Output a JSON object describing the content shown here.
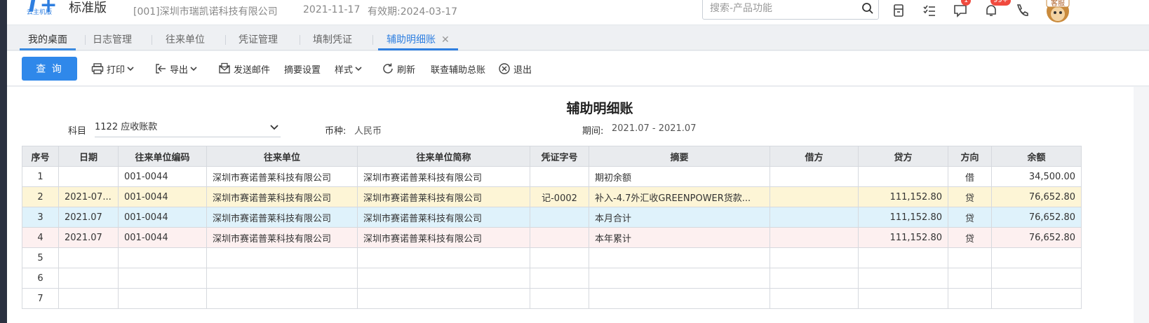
{
  "header": {
    "logo_sub": "云主机版",
    "edition": "标准版",
    "company": "[001]深圳市瑞凯诺科技有限公司",
    "date": "2021-11-17",
    "valid": "有效期:2024-03-17",
    "search_placeholder": "搜索-产品功能",
    "message_badge": "1",
    "notice_badge": "99+",
    "service_label": "客服"
  },
  "tabs": [
    {
      "label": "我的桌面"
    },
    {
      "label": "日志管理"
    },
    {
      "label": "往来单位"
    },
    {
      "label": "凭证管理"
    },
    {
      "label": "填制凭证"
    },
    {
      "label": "辅助明细账"
    }
  ],
  "toolbar": {
    "query": "查 询",
    "print": "打印",
    "export": "导出",
    "send_mail": "发送邮件",
    "summary_settings": "摘要设置",
    "style": "样式",
    "refresh": "刷新",
    "link_total": "联查辅助总账",
    "exit": "退出"
  },
  "report": {
    "title": "辅助明细账",
    "subject_label": "科目",
    "subject_value": "1122 应收账款",
    "currency_label": "币种:",
    "currency_value": "人民币",
    "period_label": "期间:",
    "period_value": "2021.07 - 2021.07"
  },
  "table": {
    "columns": [
      "序号",
      "日期",
      "往来单位编码",
      "往来单位",
      "往来单位简称",
      "凭证字号",
      "摘要",
      "借方",
      "贷方",
      "方向",
      "余额"
    ],
    "rows": [
      [
        "1",
        "",
        "001-0044",
        "深圳市赛诺普莱科技有限公司",
        "深圳市赛诺普莱科技有限公司",
        "",
        "期初余额",
        "",
        "",
        "借",
        "34,500.00"
      ],
      [
        "2",
        "2021-07...",
        "001-0044",
        "深圳市赛诺普莱科技有限公司",
        "深圳市赛诺普莱科技有限公司",
        "记-0002",
        "补入-4.7外汇收GREENPOWER货款...",
        "",
        "111,152.80",
        "贷",
        "76,652.80"
      ],
      [
        "3",
        "2021.07",
        "001-0044",
        "深圳市赛诺普莱科技有限公司",
        "深圳市赛诺普莱科技有限公司",
        "",
        "本月合计",
        "",
        "111,152.80",
        "贷",
        "76,652.80"
      ],
      [
        "4",
        "2021.07",
        "001-0044",
        "深圳市赛诺普莱科技有限公司",
        "深圳市赛诺普莱科技有限公司",
        "",
        "本年累计",
        "",
        "111,152.80",
        "贷",
        "76,652.80"
      ],
      [
        "5",
        "",
        "",
        "",
        "",
        "",
        "",
        "",
        "",
        "",
        ""
      ],
      [
        "6",
        "",
        "",
        "",
        "",
        "",
        "",
        "",
        "",
        "",
        ""
      ],
      [
        "7",
        "",
        "",
        "",
        "",
        "",
        "",
        "",
        "",
        "",
        ""
      ]
    ]
  },
  "colors": {
    "accent": "#2f88ea",
    "row_yellow": "#fdf5d6",
    "row_blue": "#dff2fb",
    "row_pink": "#fdf0f0"
  }
}
